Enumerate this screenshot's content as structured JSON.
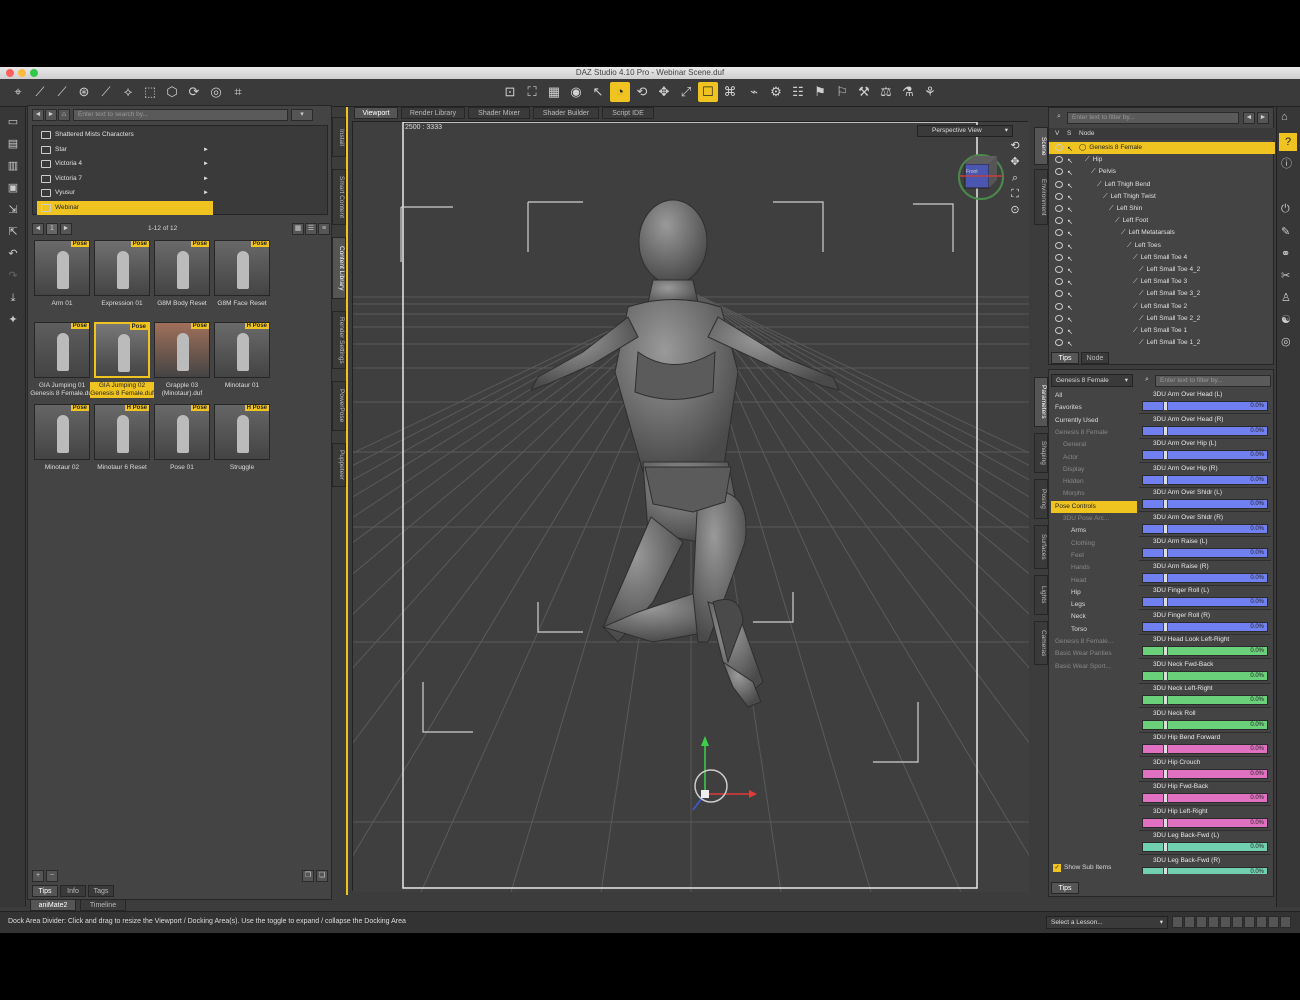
{
  "window": {
    "title": "DAZ Studio 4.10 Pro - Webinar Scene.duf"
  },
  "colors": {
    "accent": "#f0c420",
    "panel": "#444444",
    "viewport_bg": "#4a4a4a"
  },
  "toolbar": {
    "icons": [
      "universal-tool-icon",
      "node-select-icon",
      "translate-icon",
      "rotate-icon",
      "scale-icon",
      "active-pose-icon",
      "surface-select-icon",
      "geometry-editor-icon",
      "region-nav-icon",
      "joint-editor-icon",
      "camera-icon",
      "render-icon",
      "render-settings-icon",
      "scene-icon",
      "figure-icon",
      "pose-icon",
      "morph-icon",
      "lights-icon",
      "transfer-icon",
      "dforce-icon",
      "spot-render-icon",
      "screenshot-icon"
    ]
  },
  "content_library": {
    "search_placeholder": "Enter text to search by...",
    "categories": [
      {
        "label": "Shattered Mists Characters",
        "arrow": ""
      },
      {
        "label": "Star",
        "arrow": "►"
      },
      {
        "label": "Victoria 4",
        "arrow": "►"
      },
      {
        "label": "Victoria 7",
        "arrow": "►"
      },
      {
        "label": "Vyusur",
        "arrow": "►"
      },
      {
        "label": "Webinar",
        "arrow": ""
      }
    ],
    "page": "1",
    "count_label": "1-12 of 12",
    "items": [
      {
        "label": "Arm 01",
        "badge": "Pose"
      },
      {
        "label": "Expression 01",
        "badge": "Pose"
      },
      {
        "label": "G8M Body Reset",
        "badge": "Pose"
      },
      {
        "label": "G8M Face Reset",
        "badge": "Pose"
      },
      {
        "label": "GIA Jumping 01 Genesis 8 Female.duf",
        "badge": "Pose"
      },
      {
        "label": "GIA Jumping 02 Genesis 8 Female.duf",
        "badge": "Pose"
      },
      {
        "label": "Grapple 03 (Minotaur).duf",
        "badge": "Pose"
      },
      {
        "label": "Minotaur 01",
        "badge": "H Pose"
      },
      {
        "label": "Minotaur 02",
        "badge": "Pose"
      },
      {
        "label": "Minotaur 6 Reset",
        "badge": "H Pose"
      },
      {
        "label": "Pose 01",
        "badge": "Pose"
      },
      {
        "label": "Struggle",
        "badge": "H Pose"
      }
    ],
    "bottom_tabs": [
      "Tips",
      "Info",
      "Tags"
    ]
  },
  "left_vtabs": [
    "Install",
    "Smart Content",
    "Content Library",
    "Render Settings",
    "PowerPose",
    "Puppeteer"
  ],
  "viewport": {
    "tabs": [
      "Viewport",
      "Render Library",
      "Shader Mixer",
      "Shader Builder",
      "Script IDE"
    ],
    "size_label": "2500 : 3333",
    "camera": "Perspective View",
    "cube_label": "Front"
  },
  "scene": {
    "search_placeholder": "Enter text to filter by...",
    "columns": {
      "v": "V",
      "s": "S",
      "node": "Node"
    },
    "nodes": [
      {
        "label": "Genesis 8 Female",
        "indent": 0
      },
      {
        "label": "Hip",
        "indent": 1
      },
      {
        "label": "Pelvis",
        "indent": 2
      },
      {
        "label": "Left Thigh Bend",
        "indent": 3
      },
      {
        "label": "Left Thigh Twist",
        "indent": 4
      },
      {
        "label": "Left Shin",
        "indent": 5
      },
      {
        "label": "Left Foot",
        "indent": 6
      },
      {
        "label": "Left Metatarsals",
        "indent": 7
      },
      {
        "label": "Left Toes",
        "indent": 8
      },
      {
        "label": "Left Small Toe 4",
        "indent": 9
      },
      {
        "label": "Left Small Toe 4_2",
        "indent": 10
      },
      {
        "label": "Left Small Toe 3",
        "indent": 9
      },
      {
        "label": "Left Small Toe 3_2",
        "indent": 10
      },
      {
        "label": "Left Small Toe 2",
        "indent": 9
      },
      {
        "label": "Left Small Toe 2_2",
        "indent": 10
      },
      {
        "label": "Left Small Toe 1",
        "indent": 9
      },
      {
        "label": "Left Small Toe 1_2",
        "indent": 10
      }
    ],
    "bottom_tabs": [
      "Tips",
      "Node"
    ]
  },
  "right_vtabs_top": [
    "Scene",
    "Environment"
  ],
  "right_vtabs_bottom": [
    "Parameters",
    "Shaping",
    "Posing",
    "Surfaces",
    "Lights",
    "Cameras"
  ],
  "parameters": {
    "figure_select": "Genesis 8 Female",
    "filter_placeholder": "Enter text to filter by...",
    "tree": [
      {
        "label": "All",
        "state": "normal",
        "indent": 0
      },
      {
        "label": "Favorites",
        "state": "normal",
        "indent": 0
      },
      {
        "label": "Currently Used",
        "state": "normal",
        "indent": 0
      },
      {
        "label": "Genesis 8 Female",
        "state": "dim",
        "indent": 0
      },
      {
        "label": "General",
        "state": "dim",
        "indent": 1
      },
      {
        "label": "Actor",
        "state": "dim",
        "indent": 1
      },
      {
        "label": "Display",
        "state": "dim",
        "indent": 1
      },
      {
        "label": "Hidden",
        "state": "dim",
        "indent": 1
      },
      {
        "label": "Morphs",
        "state": "dim",
        "indent": 1
      },
      {
        "label": "Pose Controls",
        "state": "sel",
        "indent": 0
      },
      {
        "label": "3DU Pose Arc...",
        "state": "dim",
        "indent": 1
      },
      {
        "label": "Arms",
        "state": "normal",
        "indent": 2
      },
      {
        "label": "Clothing",
        "state": "dim",
        "indent": 2
      },
      {
        "label": "Feet",
        "state": "dim",
        "indent": 2
      },
      {
        "label": "Hands",
        "state": "dim",
        "indent": 2
      },
      {
        "label": "Head",
        "state": "dim",
        "indent": 2
      },
      {
        "label": "Hip",
        "state": "normal",
        "indent": 2
      },
      {
        "label": "Legs",
        "state": "normal",
        "indent": 2
      },
      {
        "label": "Neck",
        "state": "normal",
        "indent": 2
      },
      {
        "label": "Torso",
        "state": "normal",
        "indent": 2
      },
      {
        "label": "Genesis 8 Female...",
        "state": "dim",
        "indent": 0
      },
      {
        "label": "Basic Wear Panties",
        "state": "dim",
        "indent": 0
      },
      {
        "label": "Basic Wear Sport...",
        "state": "dim",
        "indent": 0
      }
    ],
    "show_sub_items": "Show Sub Items",
    "sliders": [
      {
        "label": "3DU Arm Over Head (L)",
        "value": "0.0%",
        "color": "#7080f0"
      },
      {
        "label": "3DU Arm Over Head (R)",
        "value": "0.0%",
        "color": "#7080f0"
      },
      {
        "label": "3DU Arm Over Hip (L)",
        "value": "0.0%",
        "color": "#7080f0"
      },
      {
        "label": "3DU Arm Over Hip (R)",
        "value": "0.0%",
        "color": "#7080f0"
      },
      {
        "label": "3DU Arm Over Shldr (L)",
        "value": "0.0%",
        "color": "#7080f0"
      },
      {
        "label": "3DU Arm Over Shldr (R)",
        "value": "0.0%",
        "color": "#7080f0"
      },
      {
        "label": "3DU Arm Raise (L)",
        "value": "0.0%",
        "color": "#7080f0"
      },
      {
        "label": "3DU Arm Raise (R)",
        "value": "0.0%",
        "color": "#7080f0"
      },
      {
        "label": "3DU Finger Roll (L)",
        "value": "0.0%",
        "color": "#7080f0"
      },
      {
        "label": "3DU Finger Roll (R)",
        "value": "0.0%",
        "color": "#7080f0"
      },
      {
        "label": "3DU Head Look Left-Right",
        "value": "0.0%",
        "color": "#6ad07a"
      },
      {
        "label": "3DU Neck Fwd-Back",
        "value": "0.0%",
        "color": "#6ad07a"
      },
      {
        "label": "3DU Neck Left-Right",
        "value": "0.0%",
        "color": "#6ad07a"
      },
      {
        "label": "3DU Neck Roll",
        "value": "0.0%",
        "color": "#6ad07a"
      },
      {
        "label": "3DU Hip Bend Forward",
        "value": "0.0%",
        "color": "#e070c0"
      },
      {
        "label": "3DU Hip Crouch",
        "value": "0.0%",
        "color": "#e070c0"
      },
      {
        "label": "3DU Hip Fwd-Back",
        "value": "0.0%",
        "color": "#e070c0"
      },
      {
        "label": "3DU Hip Left-Right",
        "value": "0.0%",
        "color": "#e070c0"
      },
      {
        "label": "3DU Leg Back-Fwd (L)",
        "value": "0.0%",
        "color": "#70d0b0"
      },
      {
        "label": "3DU Leg Back-Fwd (R)",
        "value": "0.0%",
        "color": "#70d0b0"
      }
    ],
    "bottom_tab": "Tips"
  },
  "bottom": {
    "tabs": [
      "aniMate2",
      "Timeline"
    ],
    "status": "Dock Area Divider: Click and drag to resize the Viewport / Docking Area(s). Use the toggle to expand / collapse the Docking Area",
    "lesson_select": "Select a Lesson..."
  }
}
